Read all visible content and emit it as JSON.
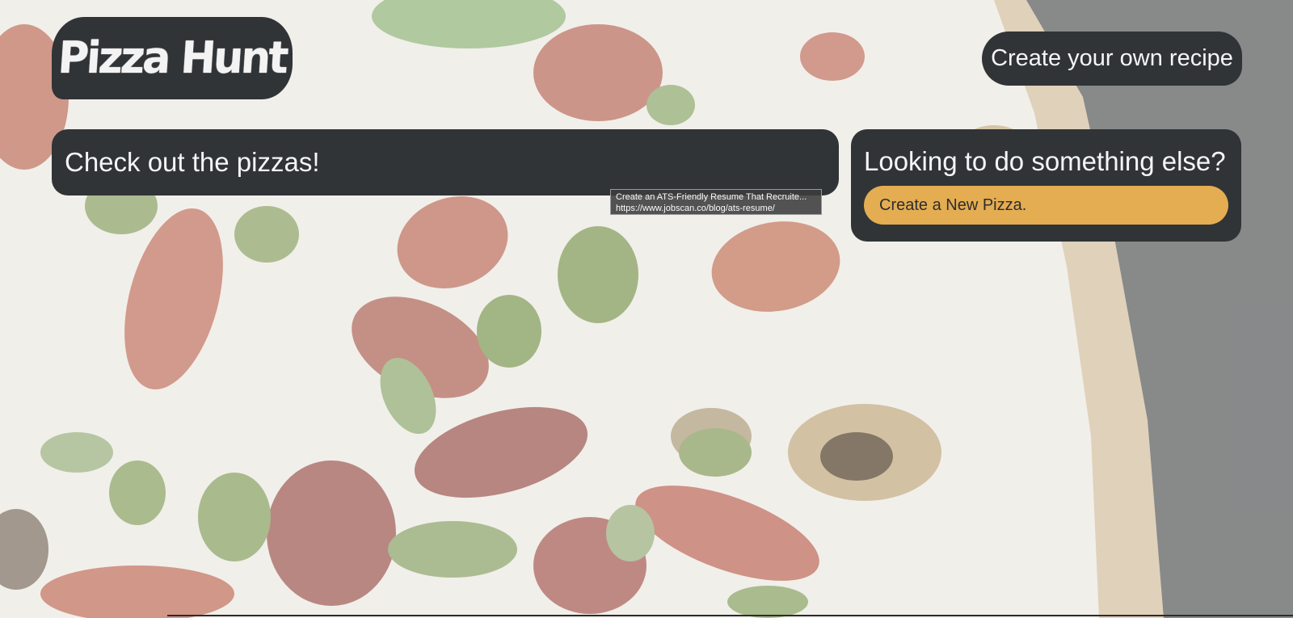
{
  "brand": {
    "logo_text": "Pizza Hunt"
  },
  "header": {
    "create_recipe_label": "Create your own recipe"
  },
  "main": {
    "pizzas_heading": "Check out the pizzas!"
  },
  "sidebar": {
    "heading": "Looking to do something else?",
    "new_pizza_label": "Create a New Pizza."
  },
  "tooltip": {
    "title": "Create an ATS-Friendly Resume That Recruite...",
    "url": "https://www.jobscan.co/blog/ats-resume/"
  },
  "colors": {
    "panel": "#303437",
    "accent": "#e4ad52",
    "text_light": "#f5f5f5"
  },
  "background": {
    "image": "washed-out pizza photo with strawberries, mozzarella and pesto"
  }
}
